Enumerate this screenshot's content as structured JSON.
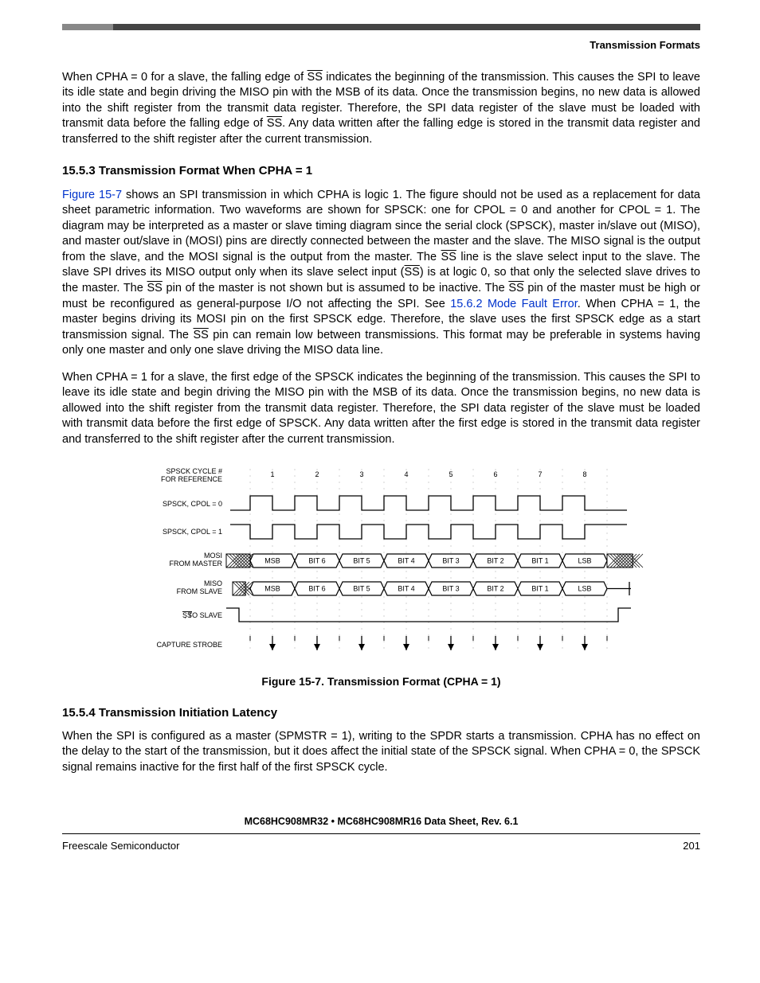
{
  "header": {
    "section_label": "Transmission Formats"
  },
  "para_intro_a": "When CPHA = 0 for a slave, the falling edge of ",
  "para_intro_b": " indicates the beginning of the transmission. This causes the SPI to leave its idle state and begin driving the MISO pin with the MSB of its data. Once the transmission begins, no new data is allowed into the shift register from the transmit data register. Therefore, the SPI data register of the slave must be loaded with transmit data before the falling edge of ",
  "para_intro_c": ". Any data written after the falling edge is stored in the transmit data register and transferred to the shift register after the current transmission.",
  "h_1553": "15.5.3  Transmission Format When CPHA = 1",
  "p1a": "Figure 15-7",
  "p1b": " shows an SPI transmission in which CPHA is logic 1. The figure should not be used as a replacement for data sheet parametric information. Two waveforms are shown for SPSCK: one for CPOL = 0 and another for CPOL = 1. The diagram may be interpreted as a master or slave timing diagram since the serial clock (SPSCK), master in/slave out (MISO), and master out/slave in (MOSI) pins are directly connected between the master and the slave. The MISO signal is the output from the slave, and the MOSI signal is the output from the master. The ",
  "p1c": " line is the slave select input to the slave. The slave SPI drives its MISO output only when its slave select input (",
  "p1d": ") is at logic 0, so that only the selected slave drives to the master. The ",
  "p1e": " pin of the master is not shown but is assumed to be inactive. The ",
  "p1f": " pin of the master must be high or must be reconfigured as general-purpose I/O not affecting the SPI. See ",
  "p1g": "15.6.2 Mode Fault Error",
  "p1h": ". When CPHA = 1, the master begins driving its MOSI pin on the first SPSCK edge. Therefore, the slave uses the first SPSCK edge as a start transmission signal. The ",
  "p1i": " pin can remain low between transmissions. This format may be preferable in systems having only one master and only one slave driving the MISO data line.",
  "p2": "When CPHA = 1 for a slave, the first edge of the SPSCK indicates the beginning of the transmission. This causes the SPI to leave its idle state and begin driving the MISO pin with the MSB of its data. Once the transmission begins, no new data is allowed into the shift register from the transmit data register. Therefore, the SPI data register of the slave must be loaded with transmit data before the first edge of SPSCK. Any data written after the first edge is stored in the transmit data register and transferred to the shift register after the current transmission.",
  "figure": {
    "labels": {
      "cycle": "SPSCK CYCLE #",
      "cycle2": "FOR REFERENCE",
      "cpol0": "SPSCK, CPOL = 0",
      "cpol1": "SPSCK, CPOL = 1",
      "mosi1": "MOSI",
      "mosi2": "FROM MASTER",
      "miso1": "MISO",
      "miso2": "FROM SLAVE",
      "ss": ", TO SLAVE",
      "ss_bar": "SS",
      "capture": "CAPTURE STROBE"
    },
    "cycles": [
      "1",
      "2",
      "3",
      "4",
      "5",
      "6",
      "7",
      "8"
    ],
    "bits": [
      "MSB",
      "BIT 6",
      "BIT 5",
      "BIT 4",
      "BIT 3",
      "BIT 2",
      "BIT 1",
      "LSB"
    ],
    "caption": "Figure 15-7. Transmission Format (CPHA = 1)"
  },
  "h_1554": "15.5.4  Transmission Initiation Latency",
  "p3": "When the SPI is configured as a master (SPMSTR = 1), writing to the SPDR starts a transmission. CPHA has no effect on the delay to the start of the transmission, but it does affect the initial state of the SPSCK signal. When CPHA = 0, the SPSCK signal remains inactive for the first half of the first SPSCK cycle.",
  "footer": {
    "doc_title": "MC68HC908MR32 • MC68HC908MR16 Data Sheet, Rev. 6.1",
    "left": "Freescale Semiconductor",
    "right": "201"
  },
  "ss_text": "SS"
}
